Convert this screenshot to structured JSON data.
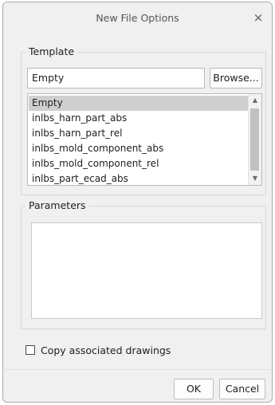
{
  "dialog": {
    "title": "New File Options",
    "close_glyph": "×"
  },
  "template": {
    "group_label": "Template",
    "input_value": "Empty",
    "browse_label": "Browse...",
    "items": [
      {
        "label": "Empty",
        "selected": true
      },
      {
        "label": "inlbs_harn_part_abs",
        "selected": false
      },
      {
        "label": "inlbs_harn_part_rel",
        "selected": false
      },
      {
        "label": "inlbs_mold_component_abs",
        "selected": false
      },
      {
        "label": "inlbs_mold_component_rel",
        "selected": false
      },
      {
        "label": "inlbs_part_ecad_abs",
        "selected": false
      }
    ]
  },
  "parameters": {
    "group_label": "Parameters"
  },
  "copy_drawings": {
    "label": "Copy associated drawings",
    "checked": false
  },
  "buttons": {
    "ok": "OK",
    "cancel": "Cancel"
  },
  "colors": {
    "dialog_bg": "#f0f0f0",
    "selected_row": "#cfcfcf"
  }
}
